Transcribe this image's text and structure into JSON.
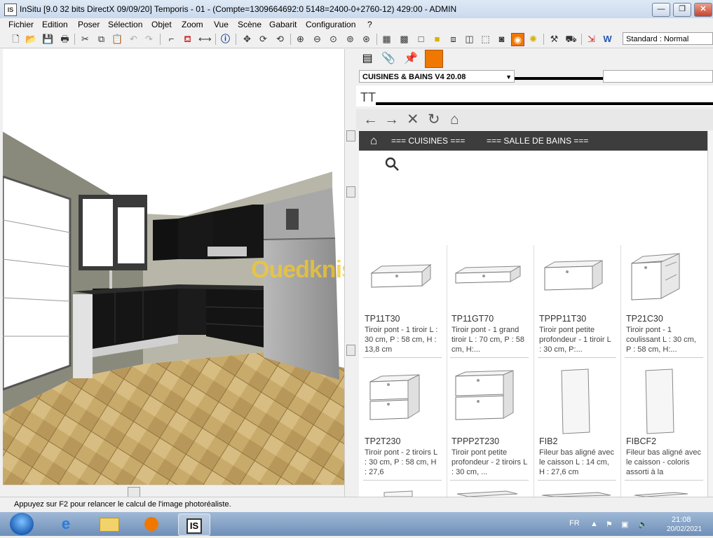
{
  "window": {
    "title": "InSitu [9.0 32 bits DirectX 09/09/20] Temporis - 01 - (Compte=1309664692:0 5148=2400-0+2760-12) 429:00 - ADMIN",
    "app_icon": "IS",
    "minimize_label": "—",
    "maximize_label": "❐",
    "close_label": "✕"
  },
  "menu": [
    "Fichier",
    "Edition",
    "Poser",
    "Sélection",
    "Objet",
    "Zoom",
    "Vue",
    "Scène",
    "Gabarit",
    "Configuration",
    "?"
  ],
  "toolbar": {
    "style_value": "Standard : Normal"
  },
  "panel": {
    "catalog_value": "CUISINES & BAINS V4 20.08",
    "tt_label": "TT",
    "nav": {
      "back": "←",
      "forward": "→",
      "stop": "✕",
      "refresh": "↻",
      "home": "⌂"
    },
    "categories": [
      "=== CUISINES ===",
      "=== SALLE DE BAINS ==="
    ],
    "products": [
      {
        "code": "TP11T30",
        "desc": "Tiroir pont - 1 tiroir L : 30 cm, P : 58 cm, H : 13,8 cm"
      },
      {
        "code": "TP11GT70",
        "desc": "Tiroir pont - 1 grand tiroir L : 70 cm, P : 58 cm, H:..."
      },
      {
        "code": "TPPP11T30",
        "desc": "Tiroir pont petite profondeur - 1 tiroir L : 30 cm, P:..."
      },
      {
        "code": "TP21C30",
        "desc": "Tiroir pont - 1 coulissant L : 30 cm, P : 58 cm, H:..."
      },
      {
        "code": "TP2T230",
        "desc": "Tiroir pont - 2 tiroirs L : 30 cm, P : 58 cm, H : 27,6"
      },
      {
        "code": "TPPP2T230",
        "desc": "Tiroir pont petite profondeur - 2 tiroirs L : 30 cm, ..."
      },
      {
        "code": "FIB2",
        "desc": "Fileur bas aligné avec le caisson L : 14 cm, H : 27,6 cm"
      },
      {
        "code": "FIBCF2",
        "desc": "Fileur bas aligné avec le caisson - coloris assorti à la"
      }
    ]
  },
  "status": "Appuyez sur F2 pour relancer le calcul de l'image photoréaliste.",
  "watermark": "Ouedkniss.com",
  "tray": {
    "lang": "FR",
    "time": "21:08",
    "date": "20/02/2021"
  },
  "colors": {
    "accent_orange": "#f07800",
    "category_bar": "#3d3d3d",
    "cabinet": "#141414"
  }
}
